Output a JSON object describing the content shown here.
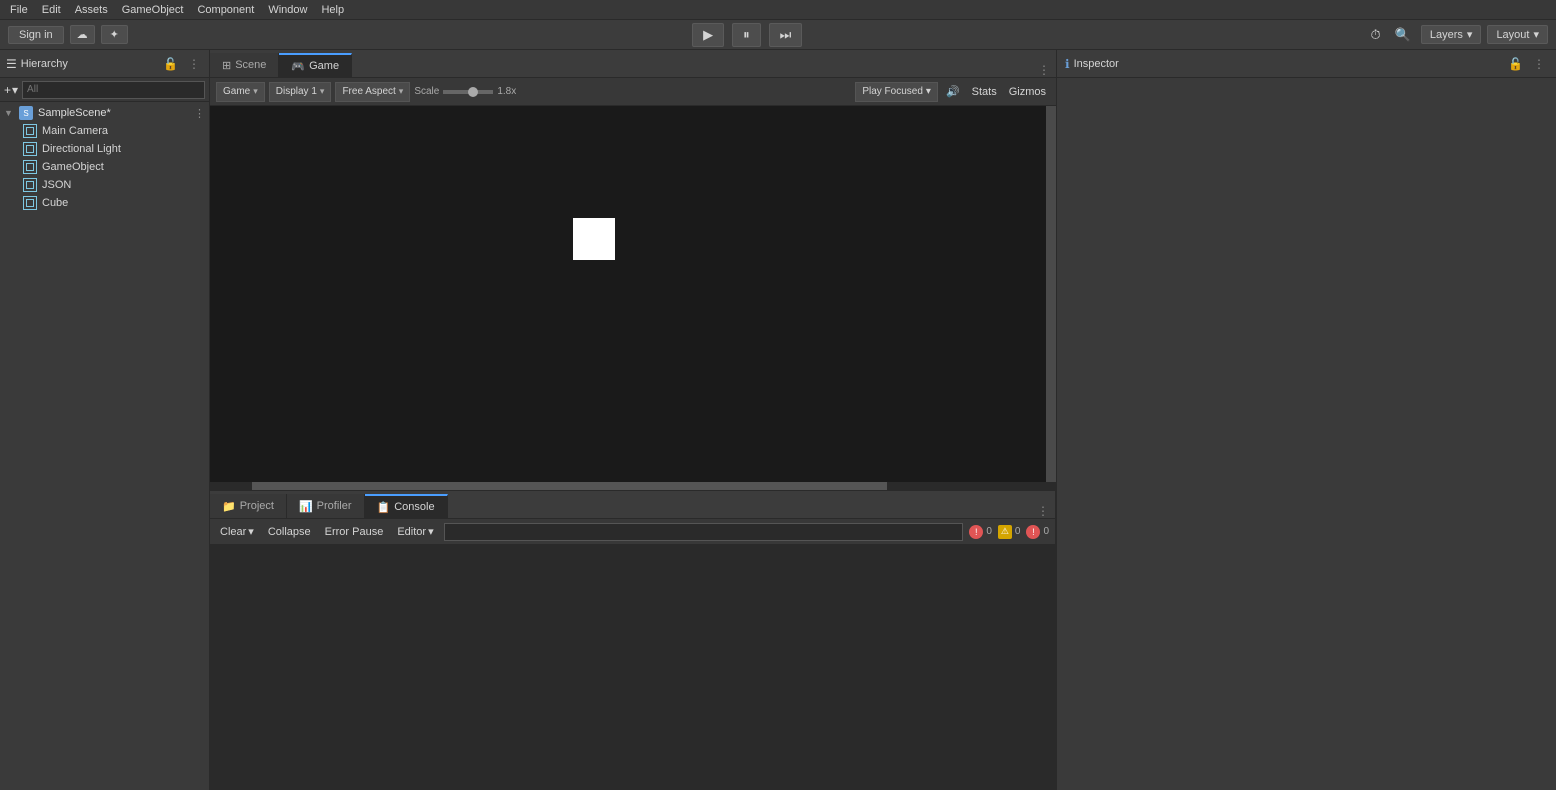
{
  "topbar": {
    "sign_in_label": "Sign in",
    "cloud_icon": "☁",
    "unity_icon": "✦",
    "play_icon": "▶",
    "pause_icon": "⏸",
    "step_icon": "⏭",
    "search_icon": "🔍",
    "history_icon": "⏱",
    "layers_label": "Layers",
    "layout_label": "Layout"
  },
  "menu": {
    "items": [
      "File",
      "Edit",
      "Assets",
      "GameObject",
      "Component",
      "Window",
      "Help"
    ]
  },
  "hierarchy": {
    "title": "Hierarchy",
    "all_label": "All",
    "scene_name": "SampleScene*",
    "items": [
      {
        "name": "Main Camera",
        "depth": 1
      },
      {
        "name": "Directional Light",
        "depth": 1
      },
      {
        "name": "GameObject",
        "depth": 1
      },
      {
        "name": "JSON",
        "depth": 1
      },
      {
        "name": "Cube",
        "depth": 1
      }
    ]
  },
  "tabs": {
    "scene_label": "Scene",
    "game_label": "Game"
  },
  "game_toolbar": {
    "game_dropdown": "Game",
    "display_label": "Display 1",
    "aspect_label": "Free Aspect",
    "scale_label": "Scale",
    "scale_value": "1.8x",
    "play_focused_label": "Play Focused",
    "stats_label": "Stats",
    "gizmos_label": "Gizmos"
  },
  "inspector": {
    "title": "Inspector"
  },
  "bottom_tabs": {
    "project_label": "Project",
    "profiler_label": "Profiler",
    "console_label": "Console"
  },
  "console_toolbar": {
    "clear_label": "Clear",
    "collapse_label": "Collapse",
    "error_pause_label": "Error Pause",
    "editor_label": "Editor",
    "search_placeholder": "",
    "error_count": "0",
    "warn_count": "0",
    "info_count": "0"
  }
}
